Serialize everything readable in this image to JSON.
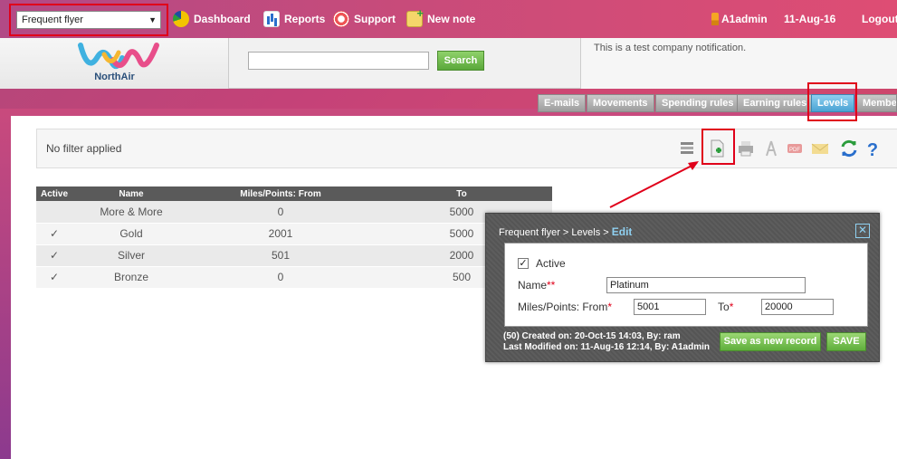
{
  "topbar": {
    "module_select": "Frequent flyer",
    "nav": [
      {
        "label": "Dashboard",
        "icon": "dashboard-icon"
      },
      {
        "label": "Reports",
        "icon": "reports-icon"
      },
      {
        "label": "Support",
        "icon": "support-icon"
      },
      {
        "label": "New note",
        "icon": "new-note-icon"
      }
    ],
    "user": "A1admin",
    "date": "11-Aug-16",
    "logout": "Logout"
  },
  "header": {
    "logo_text": "NorthAir",
    "search_button": "Search",
    "search_value": "",
    "notification": "This is a test company notification."
  },
  "tabs": [
    {
      "label": "E-mails"
    },
    {
      "label": "Movements"
    },
    {
      "label": "Spending rules"
    },
    {
      "label": "Earning rules"
    },
    {
      "label": "Levels"
    },
    {
      "label": "Members"
    }
  ],
  "active_tab": "Levels",
  "filter": {
    "text": "No filter applied"
  },
  "toolbar_icons": [
    "columns-icon",
    "new-record-icon",
    "print-icon",
    "pdf-icon",
    "pdf-export-icon",
    "email-icon",
    "refresh-icon",
    "help-icon"
  ],
  "levels_table": {
    "headers": [
      "Active",
      "Name",
      "Miles/Points: From",
      "To"
    ],
    "rows": [
      {
        "active": "",
        "name": "More & More",
        "from": "0",
        "to": "5000"
      },
      {
        "active": "✓",
        "name": "Gold",
        "from": "2001",
        "to": "5000"
      },
      {
        "active": "✓",
        "name": "Silver",
        "from": "501",
        "to": "2000"
      },
      {
        "active": "✓",
        "name": "Bronze",
        "from": "0",
        "to": "500"
      }
    ]
  },
  "dialog": {
    "breadcrumb": "Frequent flyer > Levels > ",
    "mode": "Edit",
    "active_label": "Active",
    "active_checked": "✓",
    "name_label": "Name",
    "name_required": "**",
    "name_value": "Platinum",
    "from_label": "Miles/Points: From",
    "from_required": "*",
    "from_value": "5001",
    "to_label": "To",
    "to_required": "*",
    "to_value": "20000",
    "created": "(50) Created on: 20-Oct-15 14:03, By: ram",
    "modified": "Last Modified on: 11-Aug-16 12:14, By: A1admin",
    "save_as_new": "Save as new record",
    "save": "SAVE",
    "close_glyph": "✕"
  },
  "colors": {
    "accent_red": "#e0001a",
    "active_tab": "#4aa3d4",
    "green_button": "#5fae3c"
  }
}
